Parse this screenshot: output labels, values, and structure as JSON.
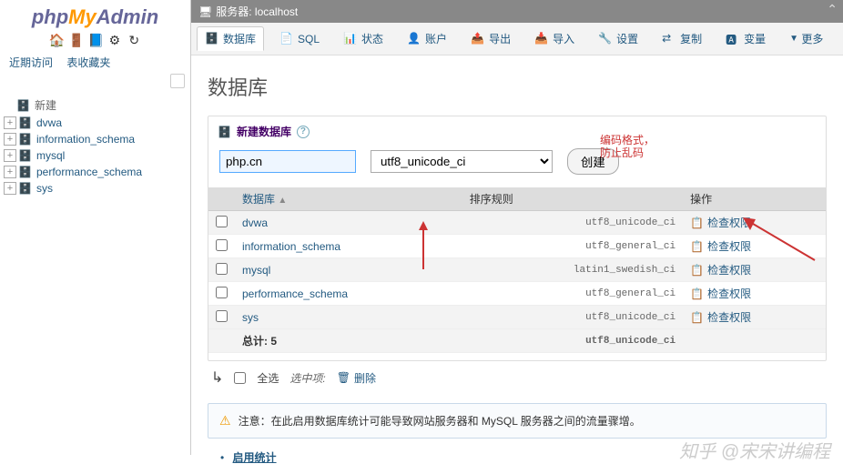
{
  "sidebar": {
    "logo_php": "php",
    "logo_my": "My",
    "logo_admin": "Admin",
    "nav": {
      "recent": "近期访问",
      "favorites": "表收藏夹"
    },
    "new_label": "新建",
    "items": [
      {
        "label": "dvwa"
      },
      {
        "label": "information_schema"
      },
      {
        "label": "mysql"
      },
      {
        "label": "performance_schema"
      },
      {
        "label": "sys"
      }
    ]
  },
  "topbar": {
    "server_label": "服务器: localhost"
  },
  "menubar": {
    "items": [
      {
        "label": "数据库"
      },
      {
        "label": "SQL"
      },
      {
        "label": "状态"
      },
      {
        "label": "账户"
      },
      {
        "label": "导出"
      },
      {
        "label": "导入"
      },
      {
        "label": "设置"
      },
      {
        "label": "复制"
      },
      {
        "label": "变量"
      },
      {
        "label": "更多"
      }
    ]
  },
  "page": {
    "title": "数据库",
    "create_legend": "新建数据库",
    "db_name_value": "php.cn",
    "collation_value": "utf8_unicode_ci",
    "create_btn": "创建",
    "annotation_line1": "编码格式，",
    "annotation_line2": "防止乱码",
    "table": {
      "headers": {
        "db": "数据库",
        "collation": "排序规则",
        "action": "操作"
      },
      "sort_icon": "▲",
      "rows": [
        {
          "name": "dvwa",
          "collation": "utf8_unicode_ci",
          "action": "检查权限"
        },
        {
          "name": "information_schema",
          "collation": "utf8_general_ci",
          "action": "检查权限"
        },
        {
          "name": "mysql",
          "collation": "latin1_swedish_ci",
          "action": "检查权限"
        },
        {
          "name": "performance_schema",
          "collation": "utf8_general_ci",
          "action": "检查权限"
        },
        {
          "name": "sys",
          "collation": "utf8_unicode_ci",
          "action": "检查权限"
        }
      ],
      "footer": {
        "total_label": "总计: 5",
        "total_collation": "utf8_unicode_ci"
      }
    },
    "bulk": {
      "check_all": "全选",
      "with_selected": "选中项:",
      "delete": "删除"
    },
    "notice": "注意：在此启用数据库统计可能导致网站服务器和 MySQL 服务器之间的流量骤增。",
    "enable_stats": "启用统计"
  },
  "watermark": "知乎 @宋宋讲编程"
}
